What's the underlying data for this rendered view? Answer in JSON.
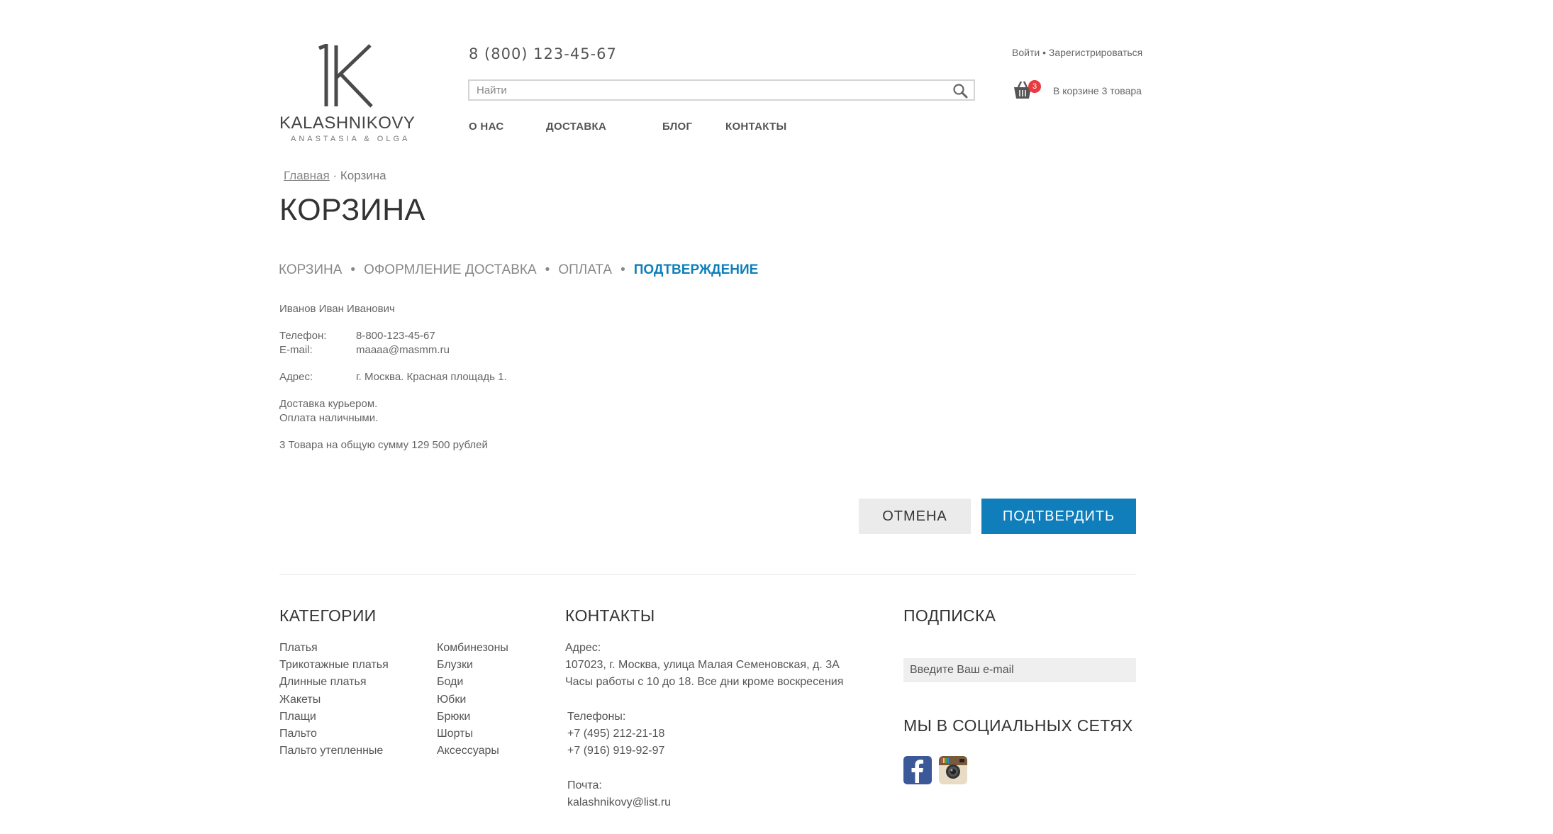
{
  "header": {
    "logo": {
      "brand": "KALASHNIKOVY",
      "sub": "ANASTASIA & OLGA"
    },
    "phone": "8 (800) 123-45-67",
    "search_placeholder": "Найти",
    "auth": {
      "login": "Войти",
      "separator": "•",
      "register": "Зарегистрироваться"
    },
    "cart": {
      "count": "3",
      "text": "В корзине 3 товара"
    },
    "nav": [
      "О НАС",
      "ДОСТАВКА",
      "БЛОГ",
      "КОНТАКТЫ"
    ]
  },
  "breadcrumb": {
    "home": "Главная",
    "separator": "·",
    "current": "Корзина"
  },
  "page_title": "КОРЗИНА",
  "steps": {
    "items": [
      "КОРЗИНА",
      "ОФОРМЛЕНИЕ",
      "ДОСТАВКА",
      "ОПЛАТА",
      "ПОДТВЕРЖДЕНИЕ"
    ],
    "dot": "•"
  },
  "order": {
    "name": "Иванов Иван Иванович",
    "phone_label": "Телефон:",
    "phone_value": "8-800-123-45-67",
    "email_label": "E-mail:",
    "email_value": "maaaa@masmm.ru",
    "address_label": "Адрес:",
    "address_value": "г.  Москва. Красная площадь 1.",
    "delivery": "Доставка курьером.",
    "payment": "Оплата наличными.",
    "summary": "3 Товара на общую сумму 129 500 рублей"
  },
  "buttons": {
    "cancel": "ОТМЕНА",
    "confirm": "ПОДТВЕРДИТЬ"
  },
  "footer": {
    "categories_title": "КАТЕГОРИИ",
    "categories_col1": [
      "Платья",
      "Трикотажные платья",
      "Длинные платья",
      "Жакеты",
      "Плащи",
      "Пальто",
      "Пальто утепленные"
    ],
    "categories_col2": [
      "Комбинезоны",
      "Блузки",
      "Боди",
      "Юбки",
      "Брюки",
      "Шорты",
      "Аксессуары"
    ],
    "contacts_title": "КОНТАКТЫ",
    "address_label": "Адрес:",
    "address": "107023, г. Москва, улица Малая Семеновская, д. 3А",
    "hours": "Часы работы с 10 до 18. Все дни кроме воскресения",
    "phones_label": "Телефоны:",
    "phone1": "+7 (495) 212-21-18",
    "phone2": "+7 (916) 919-92-97",
    "mail_label": "Почта:",
    "mail": "kalashnikovy@list.ru",
    "subscribe_title": "ПОДПИСКА",
    "subscribe_placeholder": "Введите Ваш e-mail",
    "social_title": "МЫ В СОЦИАЛЬНЫХ СЕТЯХ",
    "social_icons": [
      "facebook-icon",
      "instagram-icon"
    ]
  },
  "colors": {
    "accent": "#0f7ebb",
    "badge": "#e83a3f",
    "cancel_bg": "#ebebeb"
  }
}
